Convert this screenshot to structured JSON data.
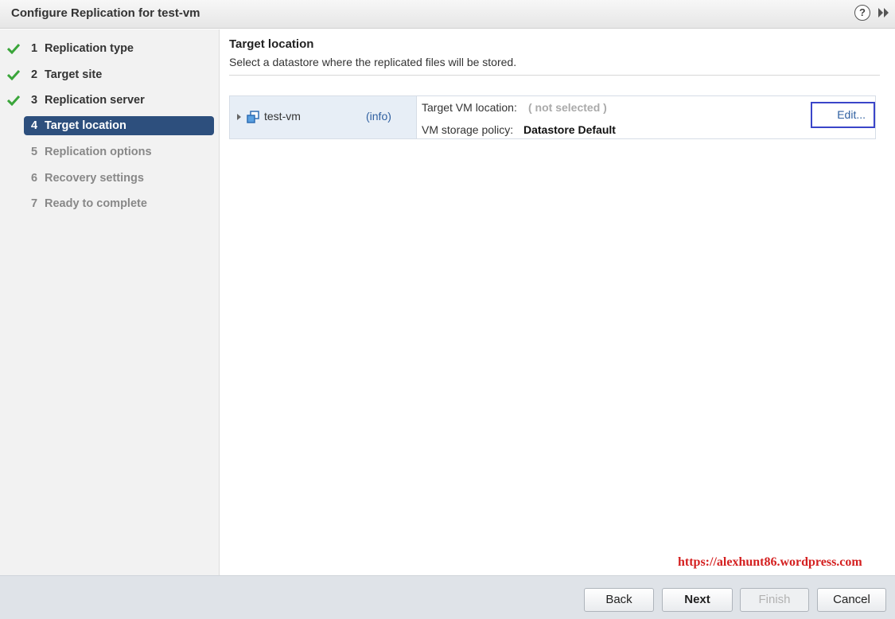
{
  "window": {
    "title": "Configure Replication for test-vm",
    "help_label": "?"
  },
  "steps": [
    {
      "num": "1",
      "label": "Replication type",
      "state": "done"
    },
    {
      "num": "2",
      "label": "Target site",
      "state": "done"
    },
    {
      "num": "3",
      "label": "Replication server",
      "state": "done"
    },
    {
      "num": "4",
      "label": "Target location",
      "state": "current"
    },
    {
      "num": "5",
      "label": "Replication options",
      "state": "todo"
    },
    {
      "num": "6",
      "label": "Recovery settings",
      "state": "todo"
    },
    {
      "num": "7",
      "label": "Ready to complete",
      "state": "todo"
    }
  ],
  "main": {
    "title": "Target location",
    "description": "Select a datastore where the replicated files will be stored.",
    "vm": {
      "name": "test-vm",
      "info_link": "(info)",
      "location_label": "Target VM location:",
      "location_value": "( not selected )",
      "policy_label": "VM storage policy:",
      "policy_value": "Datastore Default",
      "edit_label": "Edit..."
    }
  },
  "watermark": "https://alexhunt86.wordpress.com",
  "footer": {
    "back": "Back",
    "next": "Next",
    "finish": "Finish",
    "cancel": "Cancel"
  },
  "colors": {
    "current_step_bg": "#2d4f7d",
    "check_green": "#3aa53a",
    "link_blue": "#2e5fa0",
    "watermark_red": "#d42020"
  }
}
